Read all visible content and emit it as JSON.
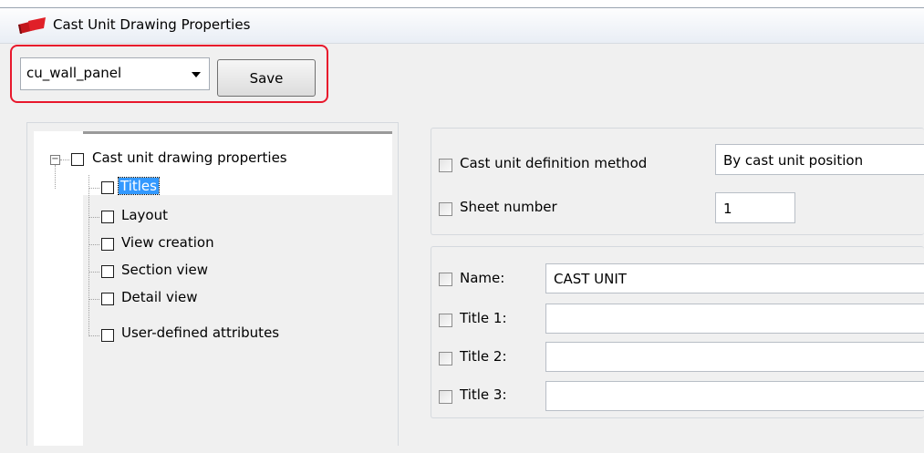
{
  "window": {
    "title": "Cast Unit Drawing Properties"
  },
  "toolbar": {
    "preset_value": "cu_wall_panel",
    "save_label": "Save"
  },
  "tree": {
    "root_label": "Cast unit drawing properties",
    "items": [
      {
        "label": "Titles",
        "selected": true
      },
      {
        "label": "Layout"
      },
      {
        "label": "View creation"
      },
      {
        "label": "Section view"
      },
      {
        "label": "Detail view"
      },
      {
        "label": "User-defined attributes"
      }
    ]
  },
  "properties": {
    "definition_method_label": "Cast unit definition method",
    "definition_method_value": "By cast unit position",
    "sheet_number_label": "Sheet number",
    "sheet_number_value": "1"
  },
  "titles": {
    "name_label": "Name:",
    "name_value": "CAST UNIT",
    "title1_label": "Title 1:",
    "title1_value": "",
    "title2_label": "Title 2:",
    "title2_value": "",
    "title3_label": "Title 3:",
    "title3_value": ""
  },
  "colors": {
    "highlight": "#e8182c",
    "selection": "#3399ff"
  }
}
